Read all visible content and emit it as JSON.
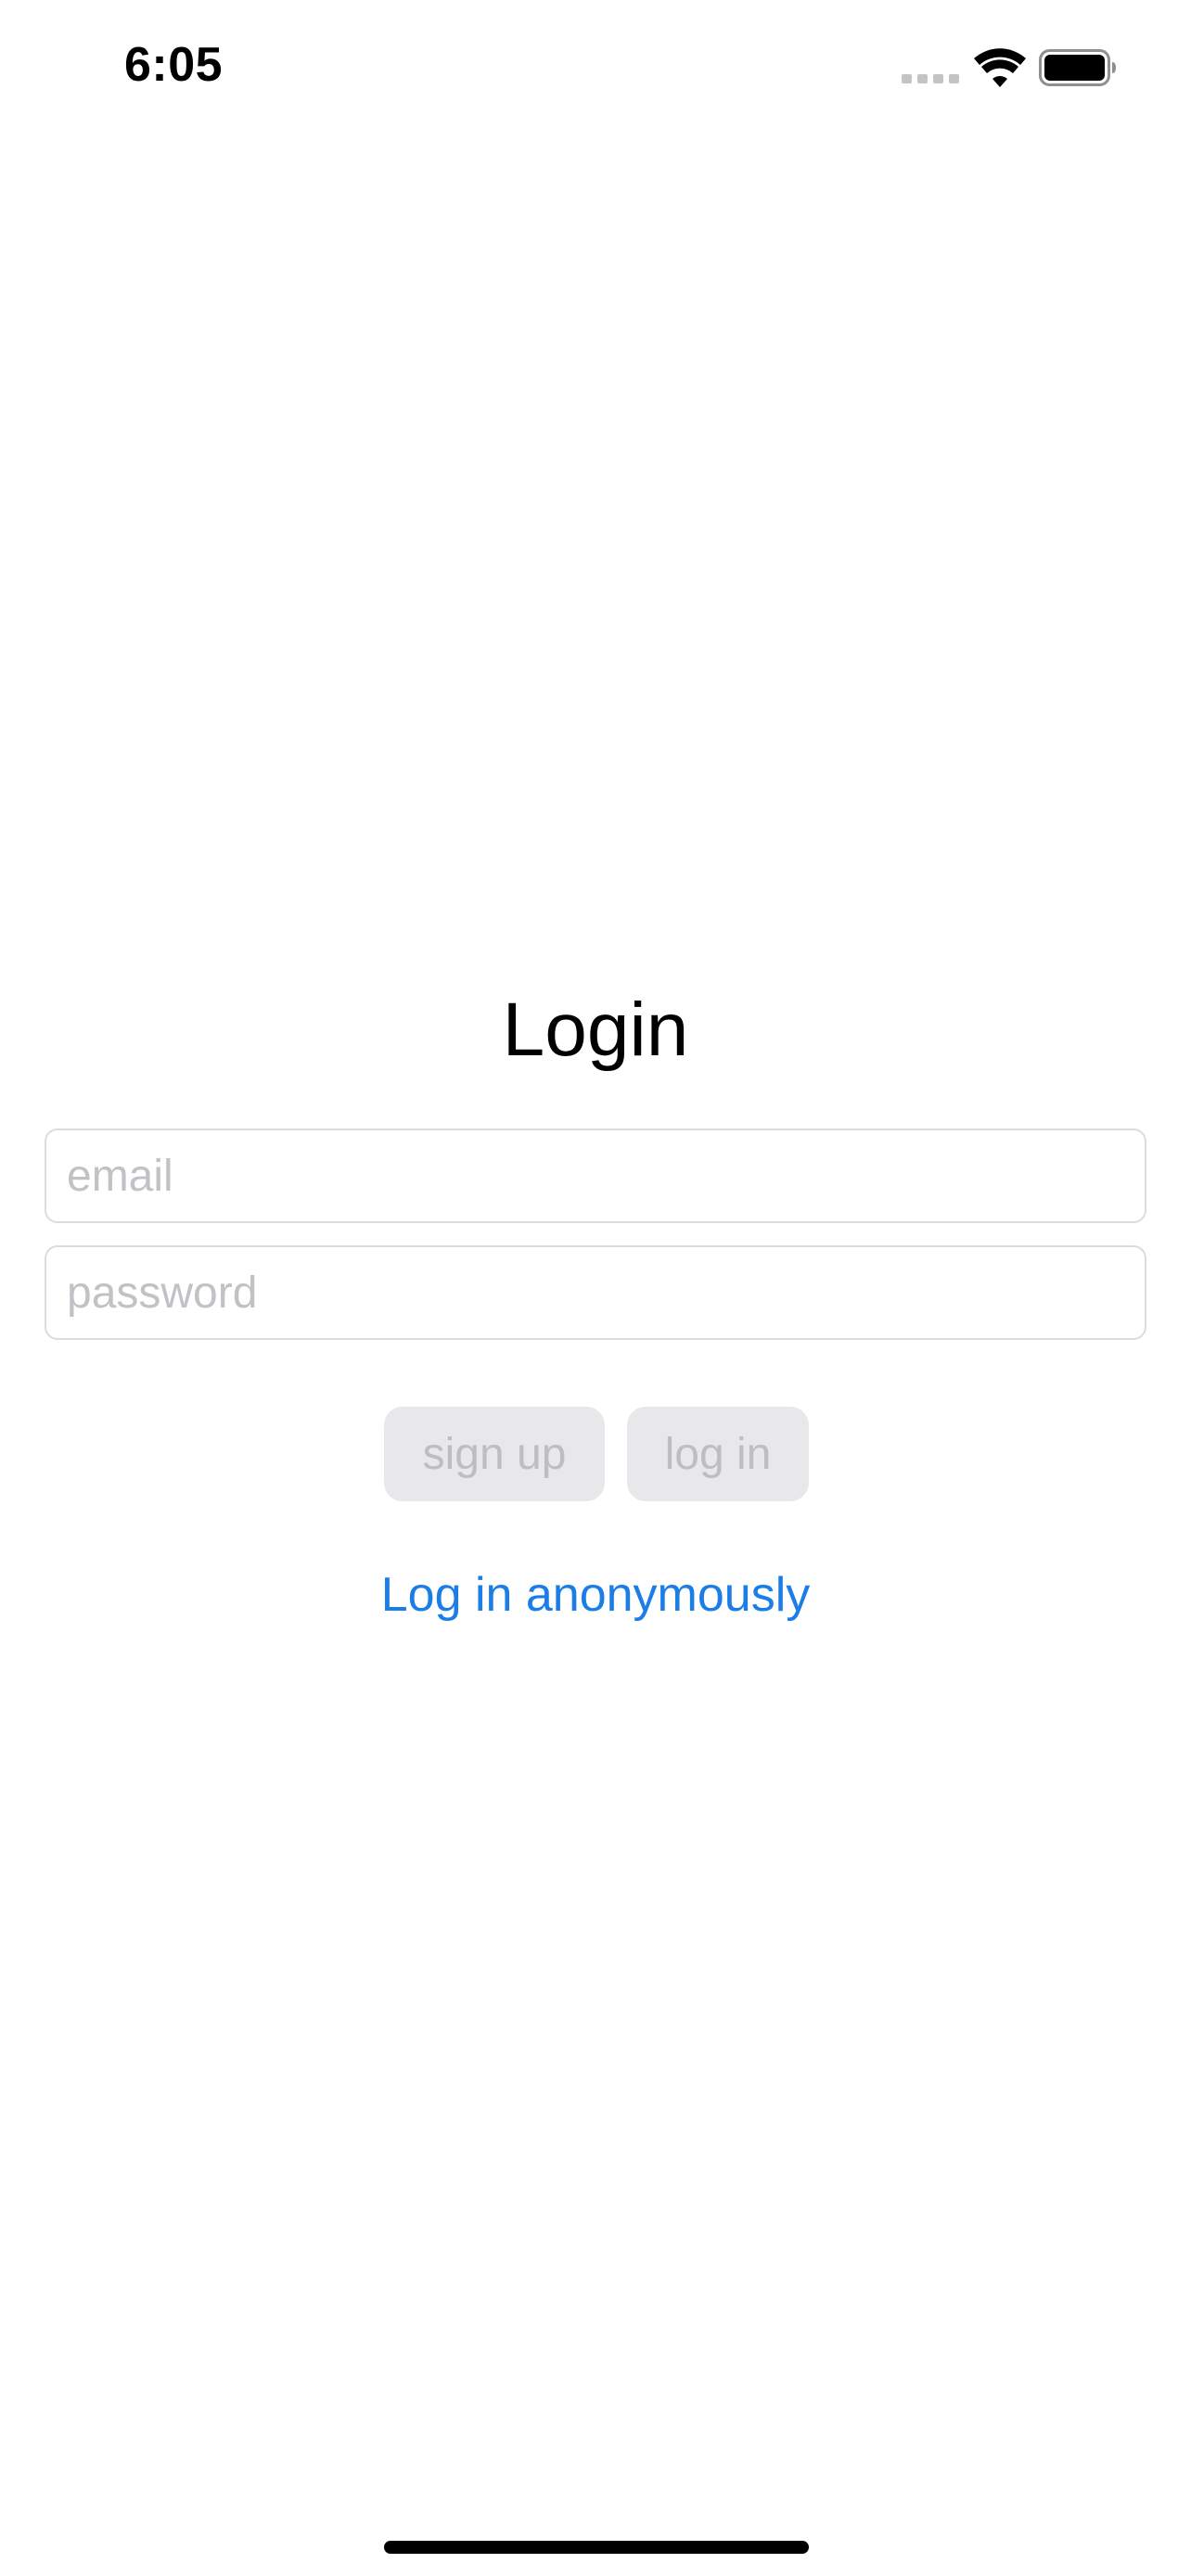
{
  "status_bar": {
    "time": "6:05",
    "icons": [
      "cellular-signal-icon",
      "wifi-icon",
      "battery-icon"
    ]
  },
  "login": {
    "title": "Login",
    "email_placeholder": "email",
    "email_value": "",
    "password_placeholder": "password",
    "password_value": "",
    "signup_label": "sign up",
    "login_label": "log in",
    "anonymous_label": "Log in anonymously"
  },
  "colors": {
    "link": "#1a7ee6",
    "button_disabled_bg": "#e8e8ea",
    "button_disabled_text": "#bebec2",
    "placeholder": "#c2c2c6",
    "field_border": "#dcdcde"
  }
}
